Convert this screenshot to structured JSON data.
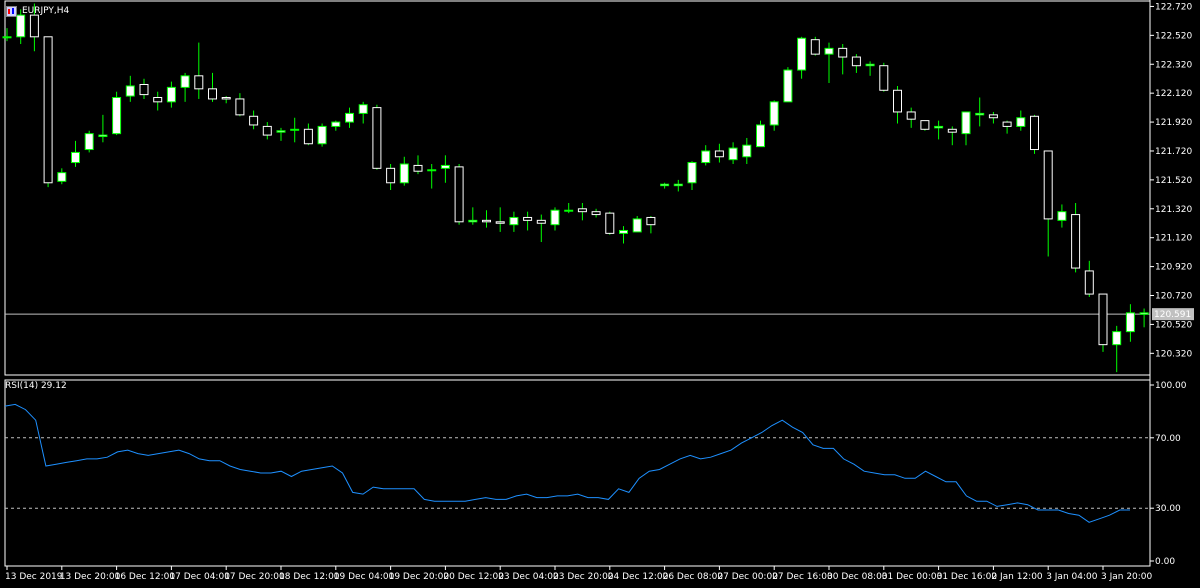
{
  "symbol": {
    "title": "EURJPY,H4",
    "icons": [
      "chart-window-icon",
      "flag-icon"
    ]
  },
  "colors": {
    "background": "#000000",
    "bull_fill": "#ffffff",
    "bear_fill": "#000000",
    "wick": "#00ff00",
    "bull_outline": "#00ff00",
    "bear_outline": "#ffffff",
    "rsi_line": "#1e90ff",
    "level_line": "#c0c0c0",
    "axis": "#ffffff",
    "price_line": "#c0c0c0",
    "price_label_bg": "#c0c0c0",
    "price_label_text": "#000000"
  },
  "chart_data": [
    {
      "type": "candlestick",
      "title": "EURJPY,H4",
      "ylim": [
        120.17,
        122.73
      ],
      "y_ticks": [
        "122.720",
        "122.520",
        "122.320",
        "122.120",
        "121.920",
        "121.720",
        "121.520",
        "121.320",
        "121.120",
        "120.920",
        "120.720",
        "120.520",
        "120.320"
      ],
      "current_price": "120.591",
      "current_price_value": 120.591,
      "candles": [
        {
          "o": 122.51,
          "h": 122.57,
          "l": 122.48,
          "c": 122.51
        },
        {
          "o": 122.51,
          "h": 122.7,
          "l": 122.46,
          "c": 122.66
        },
        {
          "o": 122.66,
          "h": 122.74,
          "l": 122.41,
          "c": 122.51
        },
        {
          "o": 122.51,
          "h": 122.51,
          "l": 121.47,
          "c": 121.5
        },
        {
          "o": 121.51,
          "h": 121.6,
          "l": 121.49,
          "c": 121.57
        },
        {
          "o": 121.64,
          "h": 121.79,
          "l": 121.61,
          "c": 121.71
        },
        {
          "o": 121.73,
          "h": 121.86,
          "l": 121.71,
          "c": 121.84
        },
        {
          "o": 121.82,
          "h": 121.97,
          "l": 121.78,
          "c": 121.83
        },
        {
          "o": 121.84,
          "h": 122.13,
          "l": 121.83,
          "c": 122.09
        },
        {
          "o": 122.1,
          "h": 122.24,
          "l": 122.06,
          "c": 122.17
        },
        {
          "o": 122.18,
          "h": 122.22,
          "l": 122.08,
          "c": 122.11
        },
        {
          "o": 122.09,
          "h": 122.13,
          "l": 122.0,
          "c": 122.06
        },
        {
          "o": 122.06,
          "h": 122.2,
          "l": 122.02,
          "c": 122.16
        },
        {
          "o": 122.16,
          "h": 122.26,
          "l": 122.06,
          "c": 122.24
        },
        {
          "o": 122.24,
          "h": 122.47,
          "l": 122.08,
          "c": 122.15
        },
        {
          "o": 122.15,
          "h": 122.26,
          "l": 122.06,
          "c": 122.08
        },
        {
          "o": 122.09,
          "h": 122.1,
          "l": 122.05,
          "c": 122.08
        },
        {
          "o": 122.08,
          "h": 122.12,
          "l": 121.96,
          "c": 121.97
        },
        {
          "o": 121.96,
          "h": 122.0,
          "l": 121.87,
          "c": 121.9
        },
        {
          "o": 121.89,
          "h": 121.92,
          "l": 121.8,
          "c": 121.83
        },
        {
          "o": 121.85,
          "h": 121.88,
          "l": 121.79,
          "c": 121.86
        },
        {
          "o": 121.87,
          "h": 121.95,
          "l": 121.78,
          "c": 121.87
        },
        {
          "o": 121.87,
          "h": 121.91,
          "l": 121.76,
          "c": 121.77
        },
        {
          "o": 121.77,
          "h": 121.91,
          "l": 121.75,
          "c": 121.89
        },
        {
          "o": 121.89,
          "h": 121.93,
          "l": 121.86,
          "c": 121.92
        },
        {
          "o": 121.92,
          "h": 122.02,
          "l": 121.88,
          "c": 121.98
        },
        {
          "o": 121.98,
          "h": 122.06,
          "l": 121.91,
          "c": 122.04
        },
        {
          "o": 122.02,
          "h": 122.04,
          "l": 121.59,
          "c": 121.6
        },
        {
          "o": 121.6,
          "h": 121.63,
          "l": 121.45,
          "c": 121.5
        },
        {
          "o": 121.5,
          "h": 121.68,
          "l": 121.48,
          "c": 121.63
        },
        {
          "o": 121.62,
          "h": 121.69,
          "l": 121.56,
          "c": 121.58
        },
        {
          "o": 121.59,
          "h": 121.63,
          "l": 121.46,
          "c": 121.59
        },
        {
          "o": 121.6,
          "h": 121.69,
          "l": 121.5,
          "c": 121.62
        },
        {
          "o": 121.61,
          "h": 121.63,
          "l": 121.21,
          "c": 121.23
        },
        {
          "o": 121.23,
          "h": 121.33,
          "l": 121.21,
          "c": 121.24
        },
        {
          "o": 121.24,
          "h": 121.31,
          "l": 121.19,
          "c": 121.23
        },
        {
          "o": 121.23,
          "h": 121.33,
          "l": 121.16,
          "c": 121.22
        },
        {
          "o": 121.21,
          "h": 121.3,
          "l": 121.16,
          "c": 121.26
        },
        {
          "o": 121.26,
          "h": 121.3,
          "l": 121.17,
          "c": 121.24
        },
        {
          "o": 121.24,
          "h": 121.28,
          "l": 121.09,
          "c": 121.22
        },
        {
          "o": 121.21,
          "h": 121.33,
          "l": 121.17,
          "c": 121.31
        },
        {
          "o": 121.31,
          "h": 121.36,
          "l": 121.29,
          "c": 121.31
        },
        {
          "o": 121.32,
          "h": 121.36,
          "l": 121.24,
          "c": 121.3
        },
        {
          "o": 121.3,
          "h": 121.32,
          "l": 121.26,
          "c": 121.28
        },
        {
          "o": 121.29,
          "h": 121.3,
          "l": 121.14,
          "c": 121.15
        },
        {
          "o": 121.15,
          "h": 121.2,
          "l": 121.08,
          "c": 121.17
        },
        {
          "o": 121.16,
          "h": 121.27,
          "l": 121.16,
          "c": 121.25
        },
        {
          "o": 121.26,
          "h": 121.27,
          "l": 121.15,
          "c": 121.21
        },
        {
          "o": 121.48,
          "h": 121.5,
          "l": 121.46,
          "c": 121.49
        },
        {
          "o": 121.48,
          "h": 121.52,
          "l": 121.44,
          "c": 121.49
        },
        {
          "o": 121.5,
          "h": 121.65,
          "l": 121.45,
          "c": 121.64
        },
        {
          "o": 121.64,
          "h": 121.76,
          "l": 121.62,
          "c": 121.72
        },
        {
          "o": 121.72,
          "h": 121.77,
          "l": 121.64,
          "c": 121.68
        },
        {
          "o": 121.66,
          "h": 121.78,
          "l": 121.63,
          "c": 121.74
        },
        {
          "o": 121.68,
          "h": 121.81,
          "l": 121.63,
          "c": 121.76
        },
        {
          "o": 121.75,
          "h": 121.93,
          "l": 121.75,
          "c": 121.9
        },
        {
          "o": 121.9,
          "h": 122.07,
          "l": 121.86,
          "c": 122.06
        },
        {
          "o": 122.06,
          "h": 122.3,
          "l": 122.06,
          "c": 122.28
        },
        {
          "o": 122.28,
          "h": 122.51,
          "l": 122.22,
          "c": 122.5
        },
        {
          "o": 122.49,
          "h": 122.51,
          "l": 122.38,
          "c": 122.39
        },
        {
          "o": 122.39,
          "h": 122.47,
          "l": 122.19,
          "c": 122.43
        },
        {
          "o": 122.43,
          "h": 122.46,
          "l": 122.25,
          "c": 122.37
        },
        {
          "o": 122.37,
          "h": 122.39,
          "l": 122.26,
          "c": 122.31
        },
        {
          "o": 122.31,
          "h": 122.34,
          "l": 122.24,
          "c": 122.32
        },
        {
          "o": 122.31,
          "h": 122.33,
          "l": 122.13,
          "c": 122.14
        },
        {
          "o": 122.14,
          "h": 122.17,
          "l": 121.91,
          "c": 121.99
        },
        {
          "o": 121.99,
          "h": 122.02,
          "l": 121.88,
          "c": 121.94
        },
        {
          "o": 121.93,
          "h": 121.93,
          "l": 121.86,
          "c": 121.87
        },
        {
          "o": 121.88,
          "h": 121.93,
          "l": 121.8,
          "c": 121.89
        },
        {
          "o": 121.87,
          "h": 121.89,
          "l": 121.76,
          "c": 121.85
        },
        {
          "o": 121.84,
          "h": 121.96,
          "l": 121.76,
          "c": 121.99
        },
        {
          "o": 121.97,
          "h": 122.09,
          "l": 121.89,
          "c": 121.98
        },
        {
          "o": 121.97,
          "h": 121.99,
          "l": 121.91,
          "c": 121.95
        },
        {
          "o": 121.92,
          "h": 121.93,
          "l": 121.84,
          "c": 121.89
        },
        {
          "o": 121.89,
          "h": 122.0,
          "l": 121.86,
          "c": 121.95
        },
        {
          "o": 121.96,
          "h": 121.97,
          "l": 121.7,
          "c": 121.73
        },
        {
          "o": 121.72,
          "h": 121.72,
          "l": 120.99,
          "c": 121.25
        },
        {
          "o": 121.24,
          "h": 121.35,
          "l": 121.19,
          "c": 121.3
        },
        {
          "o": 121.28,
          "h": 121.36,
          "l": 120.88,
          "c": 120.91
        },
        {
          "o": 120.89,
          "h": 120.96,
          "l": 120.71,
          "c": 120.73
        },
        {
          "o": 120.73,
          "h": 120.73,
          "l": 120.33,
          "c": 120.38
        },
        {
          "o": 120.38,
          "h": 120.51,
          "l": 120.19,
          "c": 120.47
        },
        {
          "o": 120.47,
          "h": 120.66,
          "l": 120.4,
          "c": 120.6
        },
        {
          "o": 120.59,
          "h": 120.63,
          "l": 120.5,
          "c": 120.6
        }
      ],
      "x_tick_labels": [
        "13 Dec 2019",
        "13 Dec 20:00",
        "16 Dec 12:00",
        "17 Dec 04:00",
        "17 Dec 20:00",
        "18 Dec 12:00",
        "19 Dec 04:00",
        "19 Dec 20:00",
        "20 Dec 12:00",
        "23 Dec 04:00",
        "23 Dec 20:00",
        "24 Dec 12:00",
        "26 Dec 08:00",
        "27 Dec 00:00",
        "27 Dec 16:00",
        "30 Dec 08:00",
        "31 Dec 00:00",
        "31 Dec 16:00",
        "2 Jan 12:00",
        "3 Jan 04:00",
        "3 Jan 20:00"
      ],
      "x_tick_candle_index": [
        0,
        4,
        8,
        12,
        16,
        20,
        24,
        28,
        32,
        36,
        40,
        44,
        48,
        52,
        56,
        60,
        64,
        68,
        72,
        76,
        80
      ]
    },
    {
      "type": "line",
      "title": "RSI(14) 29.12",
      "ylim": [
        0,
        100
      ],
      "y_ticks": [
        "100.00",
        "70.00",
        "30.00",
        "0.00"
      ],
      "levels": [
        70,
        30
      ],
      "series": [
        {
          "values": [
            88,
            89,
            86,
            80,
            54,
            55,
            56,
            57,
            58,
            58,
            59,
            62,
            63,
            61,
            60,
            61,
            62,
            63,
            61,
            58,
            57,
            57,
            54,
            52,
            51,
            50,
            50,
            51,
            48,
            51,
            52,
            53,
            54,
            50,
            39,
            38,
            42,
            41,
            41,
            41,
            41,
            35,
            34,
            34,
            34,
            34,
            35,
            36,
            35,
            35,
            37,
            38,
            36,
            36,
            37,
            37,
            38,
            36,
            36,
            35,
            41,
            39,
            47,
            51,
            52,
            55,
            58,
            60,
            58,
            59,
            61,
            63,
            67,
            70,
            73,
            77,
            80,
            76,
            73,
            66,
            64,
            64,
            58,
            55,
            51,
            50,
            49,
            49,
            47,
            47,
            51,
            48,
            45,
            45,
            37,
            34,
            34,
            31,
            32,
            33,
            32,
            29,
            29,
            29,
            27,
            26,
            22,
            24,
            26,
            29,
            29
          ]
        }
      ]
    }
  ]
}
